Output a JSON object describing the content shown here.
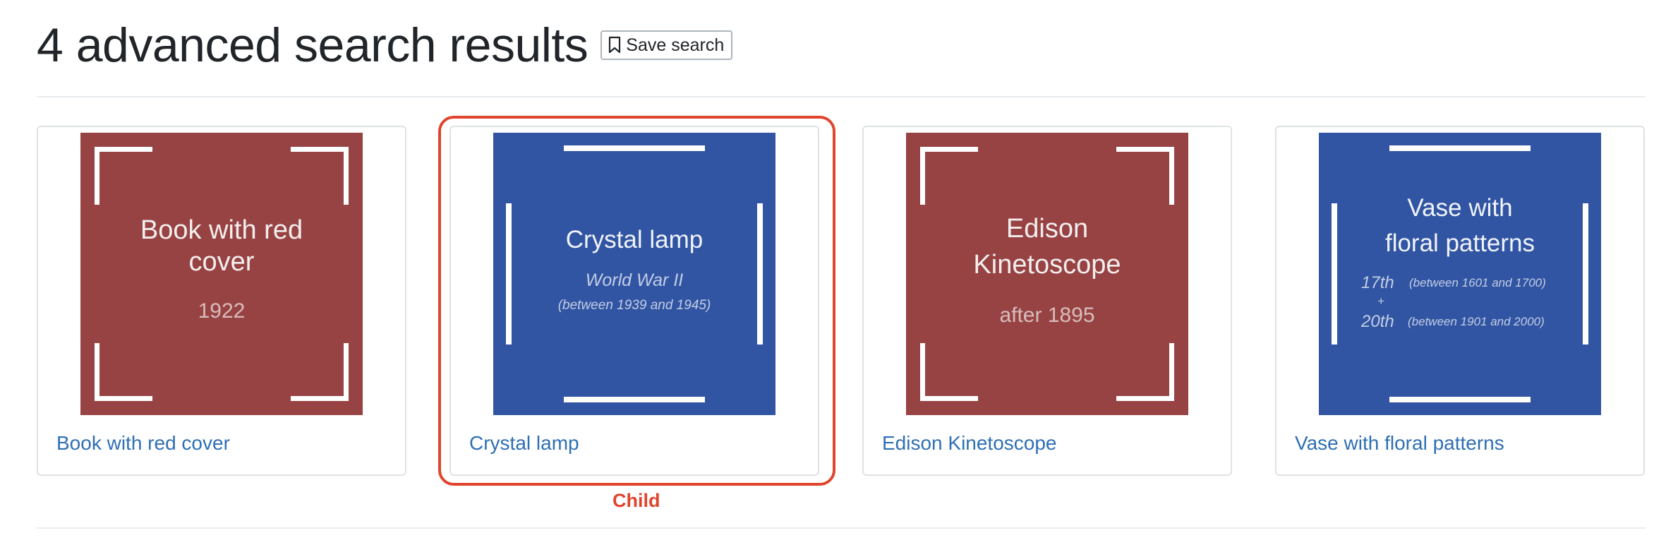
{
  "header": {
    "title": "4 advanced search results",
    "save_button_label": "Save search",
    "save_button_icon": "bookmark-icon"
  },
  "results": [
    {
      "title": "Book with red cover",
      "thumb_color": "#984343",
      "thumb_lines": [
        "Book with red",
        "cover"
      ],
      "thumb_date": "1922"
    },
    {
      "title": "Crystal lamp",
      "thumb_color": "#3155a2",
      "thumb_lines": [
        "Crystal lamp"
      ],
      "thumb_period": "World War II",
      "thumb_range": "(between 1939 and 1945)"
    },
    {
      "title": "Edison Kinetoscope",
      "thumb_color": "#984343",
      "thumb_lines": [
        "Edison",
        "Kinetoscope"
      ],
      "thumb_date": "after 1895"
    },
    {
      "title": "Vase with floral patterns",
      "thumb_color": "#3155a2",
      "thumb_lines": [
        "Vase with",
        "floral patterns"
      ],
      "thumb_century_1": "17th",
      "thumb_range_1": "(between 1601 and 1700)",
      "thumb_plus": "+",
      "thumb_century_2": "20th",
      "thumb_range_2": "(between 1901 and 2000)"
    }
  ],
  "annotation": {
    "label": "Child",
    "color": "#e0442d"
  }
}
